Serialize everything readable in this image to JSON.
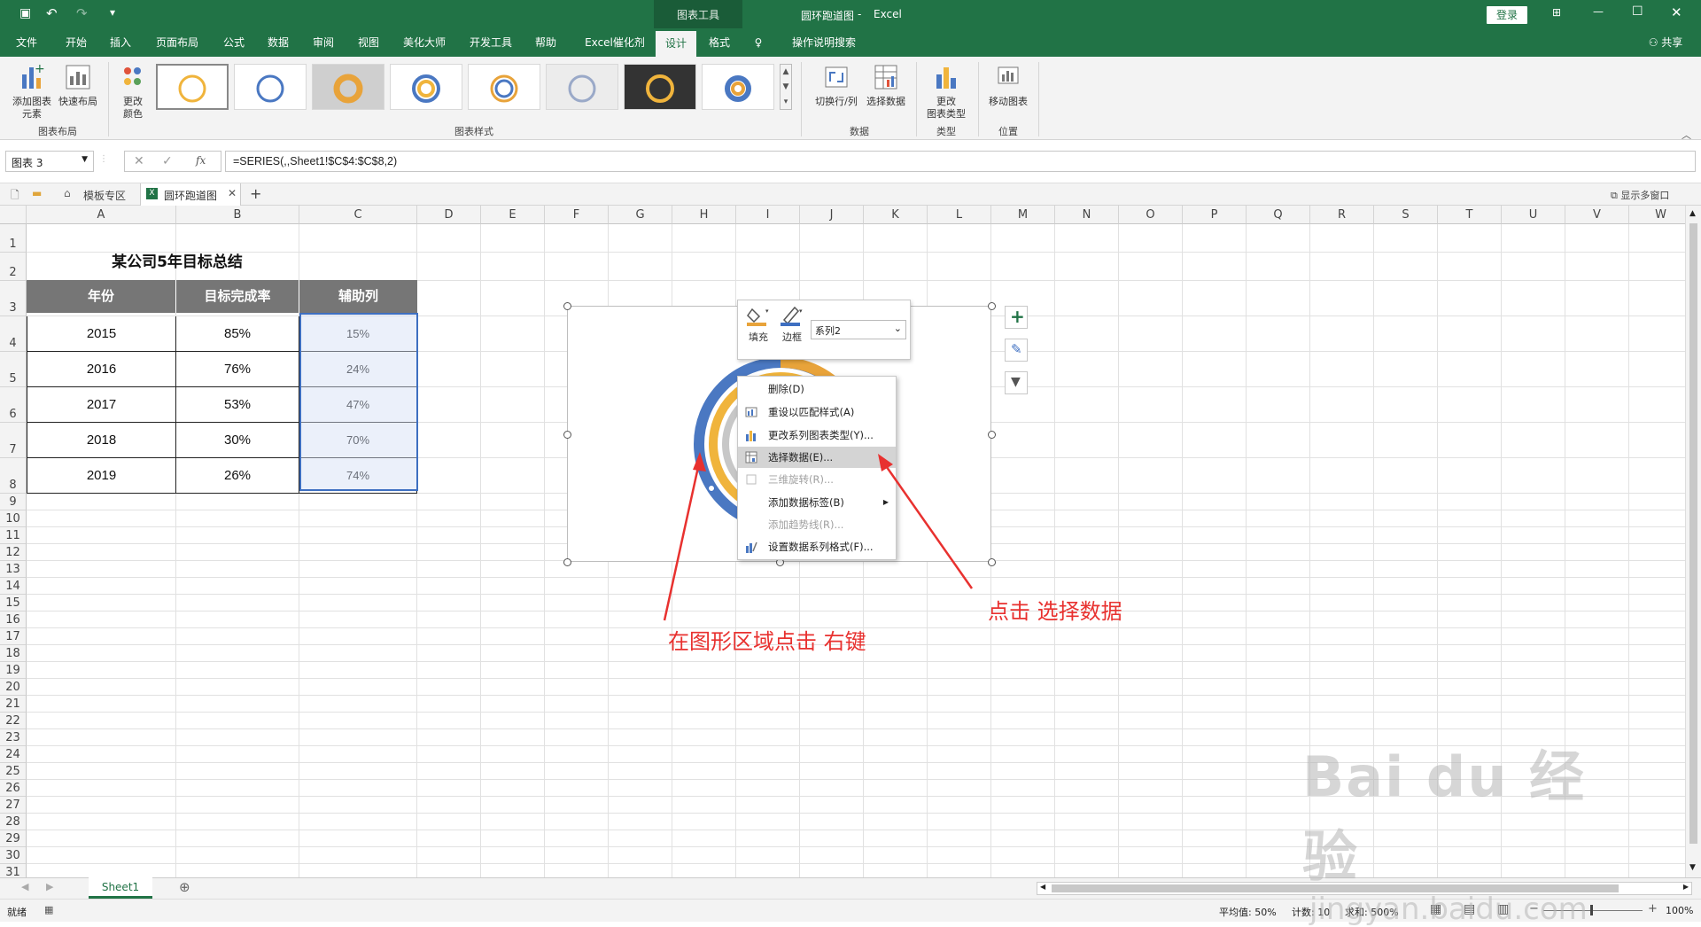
{
  "app": {
    "doc_title": "圆环跑道图",
    "app_name": "Excel",
    "context_tab": "图表工具",
    "login": "登录",
    "share": "共享"
  },
  "menu_tabs": [
    "文件",
    "开始",
    "插入",
    "页面布局",
    "公式",
    "数据",
    "审阅",
    "视图",
    "美化大师",
    "开发工具",
    "帮助",
    "Excel催化剂",
    "设计",
    "格式"
  ],
  "tell_me": "操作说明搜索",
  "ribbon": {
    "add_element": "添加图表\n元素",
    "quick_layout": "快速布局",
    "change_color": "更改\n颜色",
    "group_layout": "图表布局",
    "group_styles": "图表样式",
    "switch_rowcol": "切换行/列",
    "select_data": "选择数据",
    "group_data": "数据",
    "change_type": "更改\n图表类型",
    "group_type": "类型",
    "move_chart": "移动图表",
    "group_location": "位置",
    "colors": {
      "accent": "#217346",
      "ribbon_bg": "#f3f3f3"
    }
  },
  "formula_bar": {
    "name_box": "图表 3",
    "fx": "fx",
    "formula": "=SERIES(,,Sheet1!$C$4:$C$8,2)"
  },
  "doc_tabs": {
    "template_zone": "模板专区",
    "file_tab": "圆环跑道图",
    "multi_window": "显示多窗口"
  },
  "columns": [
    "A",
    "B",
    "C",
    "D",
    "E",
    "F",
    "G",
    "H",
    "I",
    "J",
    "K",
    "L",
    "M",
    "N",
    "O",
    "P",
    "Q",
    "R",
    "S",
    "T",
    "U",
    "V",
    "W"
  ],
  "rows": [
    "1",
    "2",
    "3",
    "4",
    "5",
    "6",
    "7",
    "8",
    "9",
    "10",
    "11",
    "12",
    "13",
    "14",
    "15",
    "16",
    "17",
    "18",
    "19",
    "20",
    "21",
    "22",
    "23",
    "24",
    "25",
    "26",
    "27",
    "28",
    "29",
    "30",
    "31"
  ],
  "table": {
    "title": "某公司5年目标总结",
    "headers": [
      "年份",
      "目标完成率",
      "辅助列"
    ],
    "rows": [
      [
        "2015",
        "85%",
        "15%"
      ],
      [
        "2016",
        "76%",
        "24%"
      ],
      [
        "2017",
        "53%",
        "47%"
      ],
      [
        "2018",
        "30%",
        "70%"
      ],
      [
        "2019",
        "26%",
        "74%"
      ]
    ]
  },
  "mini_toolbar": {
    "fill": "填充",
    "border": "边框",
    "series_select": "系列2"
  },
  "context_menu": [
    {
      "label": "删除(D)",
      "enabled": true
    },
    {
      "label": "重设以匹配样式(A)",
      "enabled": true
    },
    {
      "label": "更改系列图表类型(Y)...",
      "enabled": true
    },
    {
      "label": "选择数据(E)...",
      "enabled": true
    },
    {
      "label": "三维旋转(R)...",
      "enabled": false
    },
    {
      "label": "添加数据标签(B)",
      "enabled": true
    },
    {
      "label": "添加趋势线(R)...",
      "enabled": false
    },
    {
      "label": "设置数据系列格式(F)...",
      "enabled": true
    }
  ],
  "annotations": {
    "left": "在图形区域点击 右键",
    "right": "点击 选择数据",
    "color": "#e8312f"
  },
  "sheets": {
    "active": "Sheet1"
  },
  "status": {
    "ready": "就绪",
    "average": "平均值: 50%",
    "count": "计数: 10",
    "sum": "求和: 500%",
    "zoom": "100%"
  },
  "watermark": {
    "brand": "Bai du 经验",
    "url": "jingyan.baidu.com"
  }
}
